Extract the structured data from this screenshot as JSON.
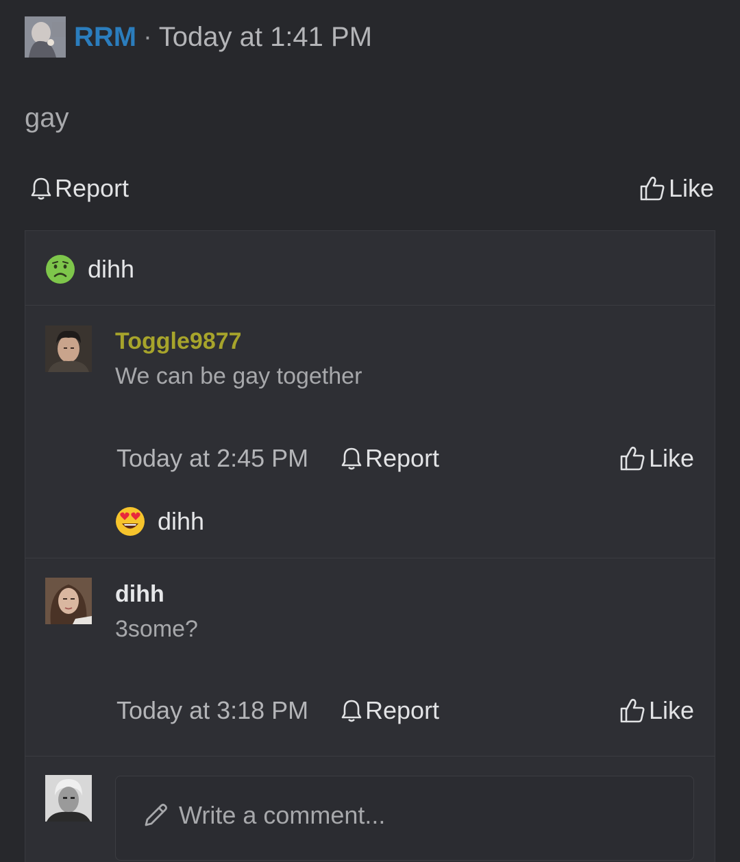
{
  "post": {
    "author": "RRM",
    "separator": "·",
    "time": "Today at 1:41 PM",
    "body": "gay",
    "report_label": "Report",
    "like_label": "Like",
    "reactions": [
      {
        "emoji": "nauseated-face",
        "user": "dihh"
      }
    ]
  },
  "comments": [
    {
      "author": "Toggle9877",
      "author_color": "#a7a42b",
      "text": "We can be gay together",
      "time": "Today at 2:45 PM",
      "report_label": "Report",
      "like_label": "Like",
      "reaction": {
        "emoji": "heart-eyes-face",
        "user": "dihh"
      }
    },
    {
      "author": "dihh",
      "author_color": "#e6e7e9",
      "text": "3some?",
      "time": "Today at 3:18 PM",
      "report_label": "Report",
      "like_label": "Like"
    }
  ],
  "composer": {
    "placeholder": "Write a comment..."
  },
  "colors": {
    "background": "#27282c",
    "panel": "#2e2f34",
    "author_link": "#2b7dbd"
  }
}
